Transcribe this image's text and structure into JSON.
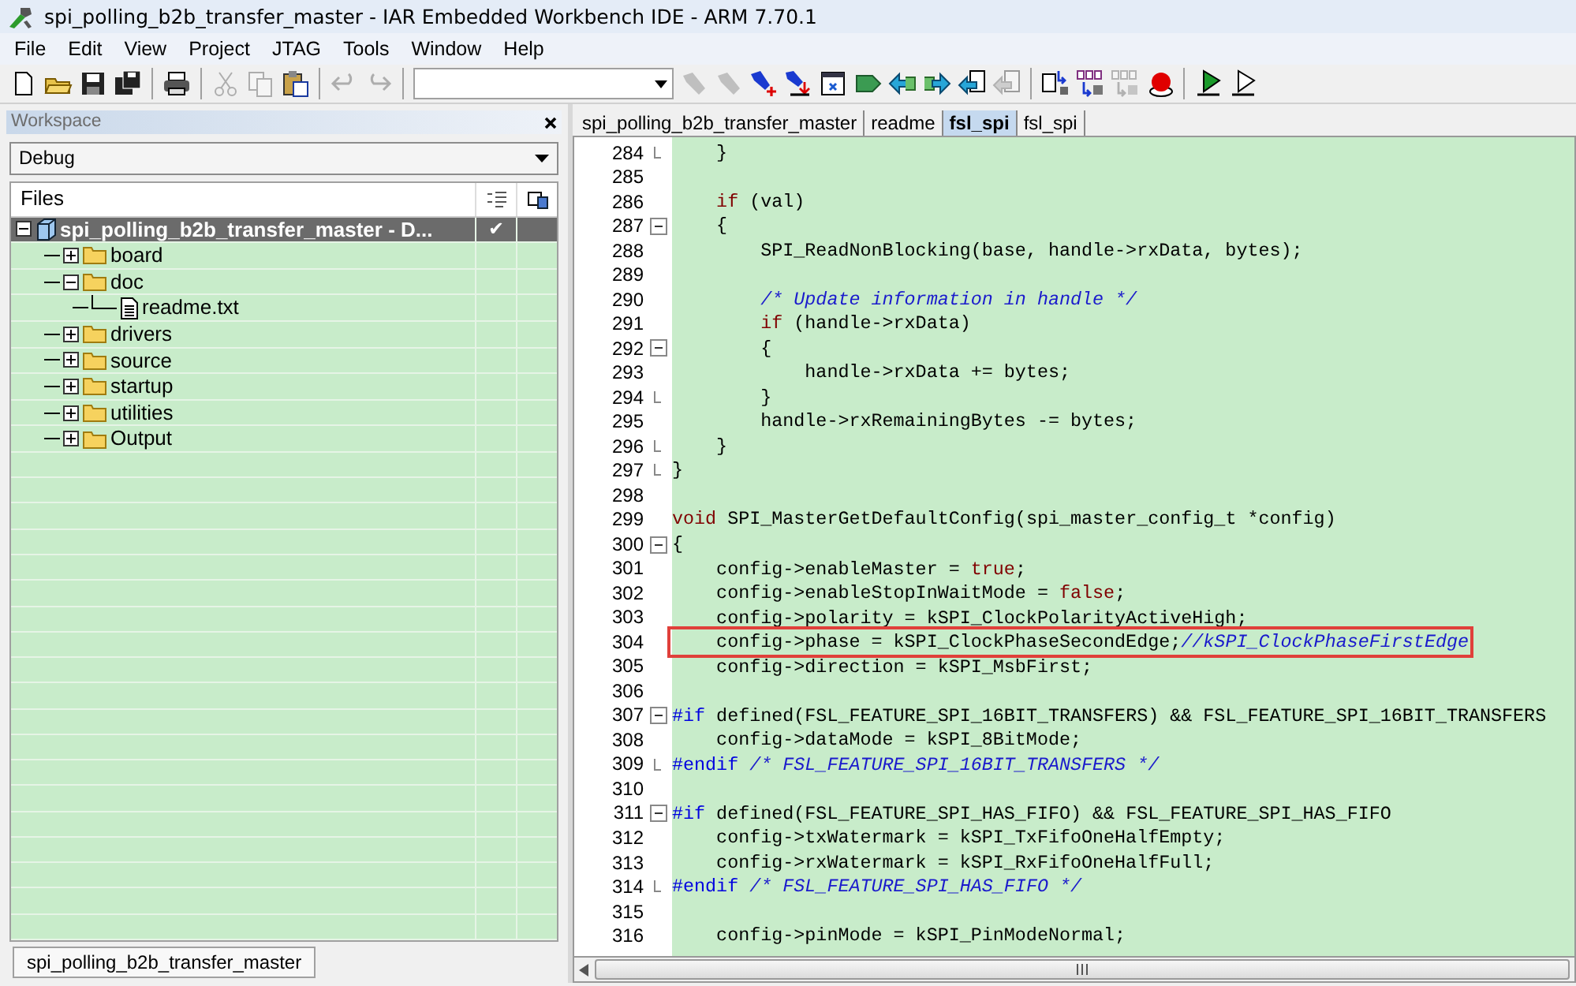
{
  "window": {
    "title": "spi_polling_b2b_transfer_master - IAR Embedded Workbench IDE - ARM 7.70.1"
  },
  "menu": [
    "File",
    "Edit",
    "View",
    "Project",
    "JTAG",
    "Tools",
    "Window",
    "Help"
  ],
  "toolbar": [
    {
      "kind": "new",
      "disabled": false
    },
    {
      "kind": "open",
      "disabled": false
    },
    {
      "kind": "save",
      "disabled": false
    },
    {
      "kind": "save-all",
      "disabled": false
    },
    {
      "kind": "sep"
    },
    {
      "kind": "print",
      "disabled": false
    },
    {
      "kind": "sep"
    },
    {
      "kind": "cut",
      "disabled": true
    },
    {
      "kind": "copy",
      "disabled": true
    },
    {
      "kind": "paste",
      "disabled": false
    },
    {
      "kind": "sep"
    },
    {
      "kind": "undo",
      "disabled": true
    },
    {
      "kind": "redo",
      "disabled": true
    },
    {
      "kind": "sep"
    },
    {
      "kind": "combo"
    },
    {
      "kind": "flashlight",
      "disabled": true
    },
    {
      "kind": "flashlight",
      "disabled": true
    },
    {
      "kind": "flashlight-add",
      "disabled": false
    },
    {
      "kind": "flashlight-remove",
      "disabled": false
    },
    {
      "kind": "window-doc",
      "disabled": false
    },
    {
      "kind": "tag",
      "disabled": false
    },
    {
      "kind": "arrow-left",
      "disabled": false
    },
    {
      "kind": "arrow-right",
      "disabled": false
    },
    {
      "kind": "arrow-doc",
      "disabled": false
    },
    {
      "kind": "arrow-doc",
      "disabled": true
    },
    {
      "kind": "sep"
    },
    {
      "kind": "step-doc",
      "disabled": false
    },
    {
      "kind": "columns",
      "disabled": false
    },
    {
      "kind": "columns",
      "disabled": true
    },
    {
      "kind": "breakpoint",
      "disabled": false
    },
    {
      "kind": "sep"
    },
    {
      "kind": "play",
      "disabled": false
    },
    {
      "kind": "play-outline",
      "disabled": false
    }
  ],
  "workspace": {
    "title": "Workspace",
    "configuration": "Debug",
    "files_header": "Files",
    "tree": [
      {
        "label": "spi_polling_b2b_transfer_master - D...",
        "kind": "project",
        "selected": true,
        "expanded": true,
        "check": "✔",
        "children": [
          {
            "label": "board",
            "kind": "folder",
            "selected": false,
            "expanded": false
          },
          {
            "label": "doc",
            "kind": "folder",
            "selected": false,
            "expanded": true,
            "children": [
              {
                "label": "readme.txt",
                "kind": "file",
                "selected": false
              }
            ]
          },
          {
            "label": "drivers",
            "kind": "folder",
            "selected": false,
            "expanded": false
          },
          {
            "label": "source",
            "kind": "folder",
            "selected": false,
            "expanded": false
          },
          {
            "label": "startup",
            "kind": "folder",
            "selected": false,
            "expanded": false
          },
          {
            "label": "utilities",
            "kind": "folder",
            "selected": false,
            "expanded": false
          },
          {
            "label": "Output",
            "kind": "folder",
            "selected": false,
            "expanded": false
          }
        ]
      }
    ],
    "bottom_tabs": [
      {
        "label": "spi_polling_b2b_transfer_master"
      }
    ]
  },
  "editor": {
    "tabs": [
      {
        "label": "spi_polling_b2b_transfer_master",
        "selected": false
      },
      {
        "label": "readme",
        "selected": false
      },
      {
        "label": "fsl_spi",
        "selected": true
      },
      {
        "label": "fsl_spi",
        "selected": false
      }
    ],
    "lines": [
      {
        "number": "284",
        "fold_end": true,
        "tokens": [
          {
            "kind": "text",
            "text": "    }"
          }
        ]
      },
      {
        "number": "285"
      },
      {
        "number": "286",
        "tokens": [
          {
            "kind": "keyword",
            "text": "    if"
          },
          {
            "kind": "text",
            "text": " (val)"
          }
        ]
      },
      {
        "number": "287",
        "fold_start": true,
        "tokens": [
          {
            "kind": "text",
            "text": "    {"
          }
        ]
      },
      {
        "number": "288",
        "tokens": [
          {
            "kind": "text",
            "text": "        SPI_ReadNonBlocking(base, handle->rxData, bytes);"
          }
        ]
      },
      {
        "number": "289"
      },
      {
        "number": "290",
        "tokens": [
          {
            "kind": "comment",
            "text": "        /* Update information in handle */"
          }
        ]
      },
      {
        "number": "291",
        "tokens": [
          {
            "kind": "keyword",
            "text": "        if"
          },
          {
            "kind": "text",
            "text": " (handle->rxData)"
          }
        ]
      },
      {
        "number": "292",
        "fold_start": true,
        "tokens": [
          {
            "kind": "text",
            "text": "        {"
          }
        ]
      },
      {
        "number": "293",
        "tokens": [
          {
            "kind": "text",
            "text": "            handle->rxData += bytes;"
          }
        ]
      },
      {
        "number": "294",
        "fold_end": true,
        "tokens": [
          {
            "kind": "text",
            "text": "        }"
          }
        ]
      },
      {
        "number": "295",
        "tokens": [
          {
            "kind": "text",
            "text": "        handle->rxRemainingBytes -= bytes;"
          }
        ]
      },
      {
        "number": "296",
        "fold_end": true,
        "tokens": [
          {
            "kind": "text",
            "text": "    }"
          }
        ]
      },
      {
        "number": "297",
        "fold_end": true,
        "tokens": [
          {
            "kind": "text",
            "text": "}"
          }
        ]
      },
      {
        "number": "298"
      },
      {
        "number": "299",
        "tokens": [
          {
            "kind": "keyword",
            "text": "void"
          },
          {
            "kind": "text",
            "text": " SPI_MasterGetDefaultConfig(spi_master_config_t *config)"
          }
        ]
      },
      {
        "number": "300",
        "fold_start": true,
        "tokens": [
          {
            "kind": "text",
            "text": "{"
          }
        ]
      },
      {
        "number": "301",
        "tokens": [
          {
            "kind": "text",
            "text": "    config->enableMaster = "
          },
          {
            "kind": "keyword",
            "text": "true"
          },
          {
            "kind": "text",
            "text": ";"
          }
        ]
      },
      {
        "number": "302",
        "tokens": [
          {
            "kind": "text",
            "text": "    config->enableStopInWaitMode = "
          },
          {
            "kind": "keyword",
            "text": "false"
          },
          {
            "kind": "text",
            "text": ";"
          }
        ]
      },
      {
        "number": "303",
        "tokens": [
          {
            "kind": "text",
            "text": "    config->polarity = kSPI_ClockPolarityActiveHigh;"
          }
        ]
      },
      {
        "number": "304",
        "highlighted": true,
        "tokens": [
          {
            "kind": "text",
            "text": "    config->phase = kSPI_ClockPhaseSecondEdge;"
          },
          {
            "kind": "comment",
            "text": "//kSPI_ClockPhaseFirstEdge"
          }
        ]
      },
      {
        "number": "305",
        "tokens": [
          {
            "kind": "text",
            "text": "    config->direction = kSPI_MsbFirst;"
          }
        ]
      },
      {
        "number": "306"
      },
      {
        "number": "307",
        "fold_start": true,
        "tokens": [
          {
            "kind": "preproc",
            "text": "#if"
          },
          {
            "kind": "text",
            "text": " defined(FSL_FEATURE_SPI_16BIT_TRANSFERS) && FSL_FEATURE_SPI_16BIT_TRANSFERS"
          }
        ]
      },
      {
        "number": "308",
        "tokens": [
          {
            "kind": "text",
            "text": "    config->dataMode = kSPI_8BitMode;"
          }
        ]
      },
      {
        "number": "309",
        "fold_end": true,
        "tokens": [
          {
            "kind": "preproc",
            "text": "#endif"
          },
          {
            "kind": "comment",
            "text": " /* FSL_FEATURE_SPI_16BIT_TRANSFERS */"
          }
        ]
      },
      {
        "number": "310"
      },
      {
        "number": "311",
        "fold_start": true,
        "tokens": [
          {
            "kind": "preproc",
            "text": "#if"
          },
          {
            "kind": "text",
            "text": " defined(FSL_FEATURE_SPI_HAS_FIFO) && FSL_FEATURE_SPI_HAS_FIFO"
          }
        ]
      },
      {
        "number": "312",
        "tokens": [
          {
            "kind": "text",
            "text": "    config->txWatermark = kSPI_TxFifoOneHalfEmpty;"
          }
        ]
      },
      {
        "number": "313",
        "tokens": [
          {
            "kind": "text",
            "text": "    config->rxWatermark = kSPI_RxFifoOneHalfFull;"
          }
        ]
      },
      {
        "number": "314",
        "fold_end": true,
        "tokens": [
          {
            "kind": "preproc",
            "text": "#endif"
          },
          {
            "kind": "comment",
            "text": " /* FSL_FEATURE_SPI_HAS_FIFO */"
          }
        ]
      },
      {
        "number": "315"
      },
      {
        "number": "316",
        "tokens": [
          {
            "kind": "text",
            "text": "    config->pinMode = kSPI_PinModeNormal;"
          }
        ]
      }
    ]
  }
}
